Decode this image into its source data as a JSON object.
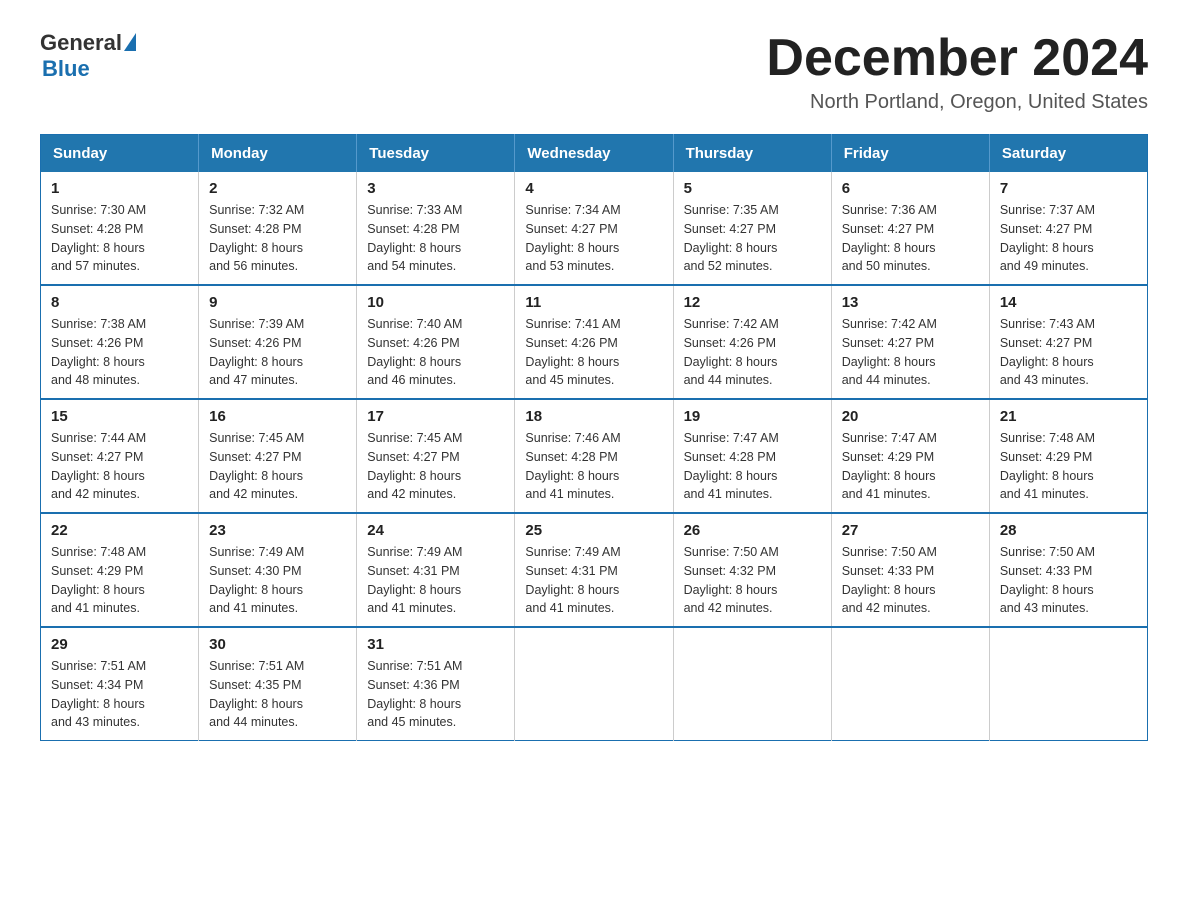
{
  "header": {
    "logo_general": "General",
    "logo_blue": "Blue",
    "title": "December 2024",
    "subtitle": "North Portland, Oregon, United States"
  },
  "days_of_week": [
    "Sunday",
    "Monday",
    "Tuesday",
    "Wednesday",
    "Thursday",
    "Friday",
    "Saturday"
  ],
  "weeks": [
    [
      {
        "day": "1",
        "sunrise": "7:30 AM",
        "sunset": "4:28 PM",
        "daylight": "8 hours and 57 minutes."
      },
      {
        "day": "2",
        "sunrise": "7:32 AM",
        "sunset": "4:28 PM",
        "daylight": "8 hours and 56 minutes."
      },
      {
        "day": "3",
        "sunrise": "7:33 AM",
        "sunset": "4:28 PM",
        "daylight": "8 hours and 54 minutes."
      },
      {
        "day": "4",
        "sunrise": "7:34 AM",
        "sunset": "4:27 PM",
        "daylight": "8 hours and 53 minutes."
      },
      {
        "day": "5",
        "sunrise": "7:35 AM",
        "sunset": "4:27 PM",
        "daylight": "8 hours and 52 minutes."
      },
      {
        "day": "6",
        "sunrise": "7:36 AM",
        "sunset": "4:27 PM",
        "daylight": "8 hours and 50 minutes."
      },
      {
        "day": "7",
        "sunrise": "7:37 AM",
        "sunset": "4:27 PM",
        "daylight": "8 hours and 49 minutes."
      }
    ],
    [
      {
        "day": "8",
        "sunrise": "7:38 AM",
        "sunset": "4:26 PM",
        "daylight": "8 hours and 48 minutes."
      },
      {
        "day": "9",
        "sunrise": "7:39 AM",
        "sunset": "4:26 PM",
        "daylight": "8 hours and 47 minutes."
      },
      {
        "day": "10",
        "sunrise": "7:40 AM",
        "sunset": "4:26 PM",
        "daylight": "8 hours and 46 minutes."
      },
      {
        "day": "11",
        "sunrise": "7:41 AM",
        "sunset": "4:26 PM",
        "daylight": "8 hours and 45 minutes."
      },
      {
        "day": "12",
        "sunrise": "7:42 AM",
        "sunset": "4:26 PM",
        "daylight": "8 hours and 44 minutes."
      },
      {
        "day": "13",
        "sunrise": "7:42 AM",
        "sunset": "4:27 PM",
        "daylight": "8 hours and 44 minutes."
      },
      {
        "day": "14",
        "sunrise": "7:43 AM",
        "sunset": "4:27 PM",
        "daylight": "8 hours and 43 minutes."
      }
    ],
    [
      {
        "day": "15",
        "sunrise": "7:44 AM",
        "sunset": "4:27 PM",
        "daylight": "8 hours and 42 minutes."
      },
      {
        "day": "16",
        "sunrise": "7:45 AM",
        "sunset": "4:27 PM",
        "daylight": "8 hours and 42 minutes."
      },
      {
        "day": "17",
        "sunrise": "7:45 AM",
        "sunset": "4:27 PM",
        "daylight": "8 hours and 42 minutes."
      },
      {
        "day": "18",
        "sunrise": "7:46 AM",
        "sunset": "4:28 PM",
        "daylight": "8 hours and 41 minutes."
      },
      {
        "day": "19",
        "sunrise": "7:47 AM",
        "sunset": "4:28 PM",
        "daylight": "8 hours and 41 minutes."
      },
      {
        "day": "20",
        "sunrise": "7:47 AM",
        "sunset": "4:29 PM",
        "daylight": "8 hours and 41 minutes."
      },
      {
        "day": "21",
        "sunrise": "7:48 AM",
        "sunset": "4:29 PM",
        "daylight": "8 hours and 41 minutes."
      }
    ],
    [
      {
        "day": "22",
        "sunrise": "7:48 AM",
        "sunset": "4:29 PM",
        "daylight": "8 hours and 41 minutes."
      },
      {
        "day": "23",
        "sunrise": "7:49 AM",
        "sunset": "4:30 PM",
        "daylight": "8 hours and 41 minutes."
      },
      {
        "day": "24",
        "sunrise": "7:49 AM",
        "sunset": "4:31 PM",
        "daylight": "8 hours and 41 minutes."
      },
      {
        "day": "25",
        "sunrise": "7:49 AM",
        "sunset": "4:31 PM",
        "daylight": "8 hours and 41 minutes."
      },
      {
        "day": "26",
        "sunrise": "7:50 AM",
        "sunset": "4:32 PM",
        "daylight": "8 hours and 42 minutes."
      },
      {
        "day": "27",
        "sunrise": "7:50 AM",
        "sunset": "4:33 PM",
        "daylight": "8 hours and 42 minutes."
      },
      {
        "day": "28",
        "sunrise": "7:50 AM",
        "sunset": "4:33 PM",
        "daylight": "8 hours and 43 minutes."
      }
    ],
    [
      {
        "day": "29",
        "sunrise": "7:51 AM",
        "sunset": "4:34 PM",
        "daylight": "8 hours and 43 minutes."
      },
      {
        "day": "30",
        "sunrise": "7:51 AM",
        "sunset": "4:35 PM",
        "daylight": "8 hours and 44 minutes."
      },
      {
        "day": "31",
        "sunrise": "7:51 AM",
        "sunset": "4:36 PM",
        "daylight": "8 hours and 45 minutes."
      },
      null,
      null,
      null,
      null
    ]
  ],
  "labels": {
    "sunrise": "Sunrise:",
    "sunset": "Sunset:",
    "daylight": "Daylight:"
  }
}
